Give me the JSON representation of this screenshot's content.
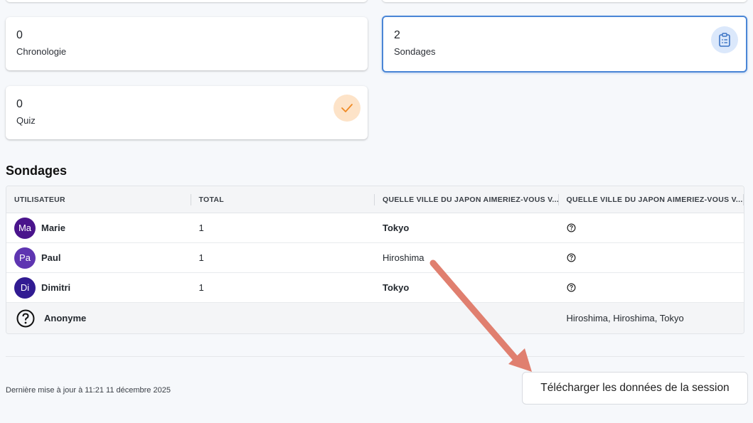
{
  "cards": [
    {
      "count": "0",
      "label": "Chronologie"
    },
    {
      "count": "2",
      "label": "Sondages",
      "icon": "clipboard-list-icon",
      "selected": true
    },
    {
      "count": "0",
      "label": "Quiz",
      "icon": "checkmark-icon"
    }
  ],
  "colors": {
    "accent": "#4a86d6",
    "sondages_badge_bg": "#dbe8fb",
    "quiz_badge_bg": "#fde3c8",
    "quiz_check": "#f08a24",
    "annotation_arrow": "#e07f6f"
  },
  "section": {
    "title": "Sondages"
  },
  "table": {
    "headers": [
      "UTILISATEUR",
      "TOTAL",
      "QUELLE VILLE DU JAPON AIMERIEZ-VOUS V...",
      "QUELLE VILLE DU JAPON AIMERIEZ-VOUS V..."
    ],
    "rows": [
      {
        "initials": "Ma",
        "name": "Marie",
        "total": "1",
        "q1": "Tokyo",
        "q1_bold": true,
        "q2_icon": "question-circle-icon",
        "avatar_color": "#4a148c"
      },
      {
        "initials": "Pa",
        "name": "Paul",
        "total": "1",
        "q1": "Hiroshima",
        "q1_bold": false,
        "q2_icon": "question-circle-icon",
        "avatar_color": "#5e35b1"
      },
      {
        "initials": "Di",
        "name": "Dimitri",
        "total": "1",
        "q1": "Tokyo",
        "q1_bold": true,
        "q2_icon": "question-circle-icon",
        "avatar_color": "#311b92"
      }
    ],
    "summary": {
      "name": "Anonyme",
      "icon": "question-circle-icon",
      "q2": "Hiroshima, Hiroshima, Tokyo"
    }
  },
  "footer": {
    "last_update": "Dernière mise à jour à 11:21 11 décembre 2025",
    "download_label": "Télécharger les données de la session"
  }
}
